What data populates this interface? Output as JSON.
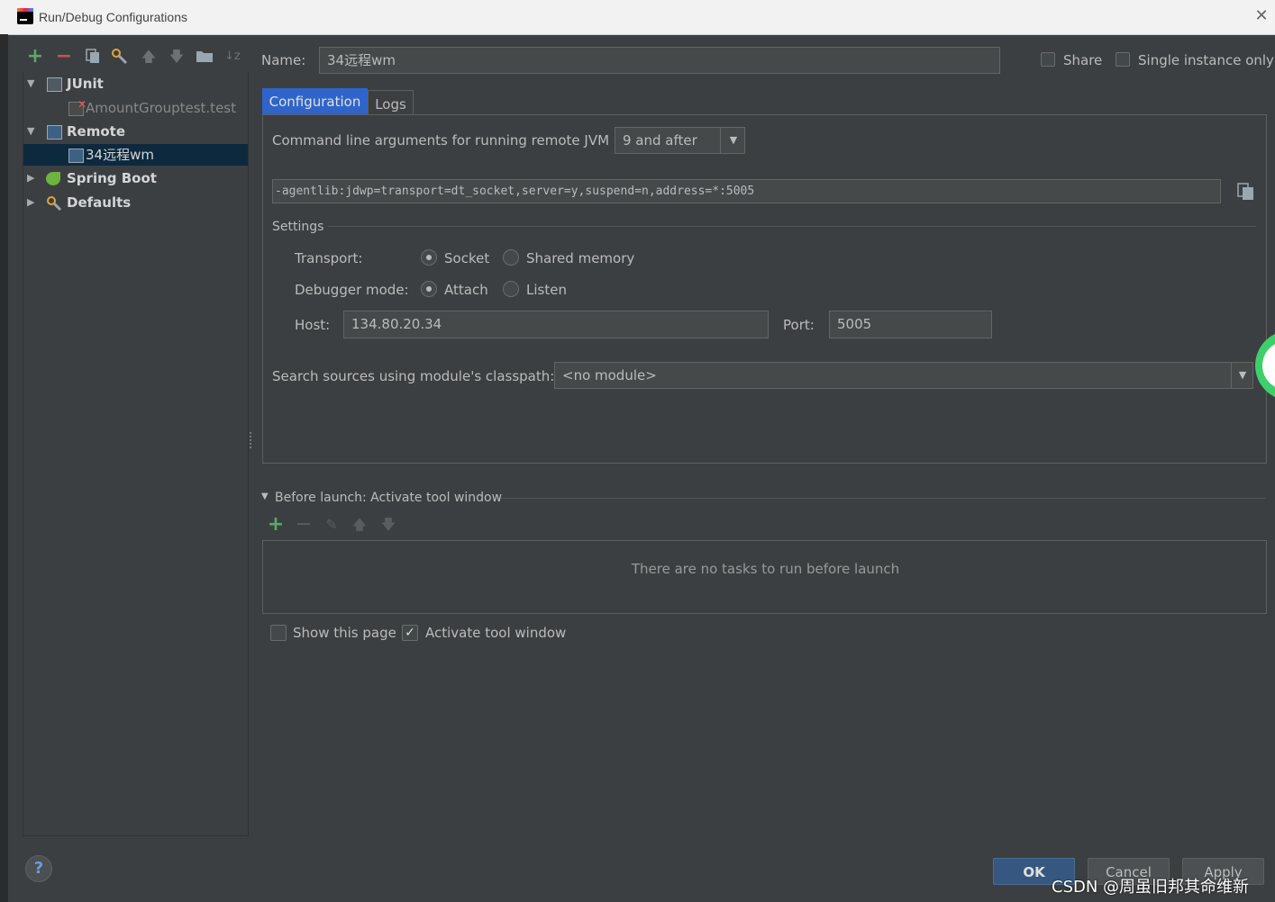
{
  "window": {
    "title": "Run/Debug Configurations"
  },
  "toolbar": {
    "icons": [
      "add-icon",
      "remove-icon",
      "copy-icon",
      "wrench-icon",
      "arrow-up-icon",
      "arrow-down-icon",
      "folder-icon",
      "sort-icon"
    ]
  },
  "tree": {
    "items": [
      {
        "label": "JUnit",
        "level": 0,
        "expanded": true,
        "bold": true
      },
      {
        "label": "AmountGrouptest.test",
        "level": 1,
        "dimmed": true
      },
      {
        "label": "Remote",
        "level": 0,
        "expanded": true,
        "bold": true
      },
      {
        "label": "34远程wm",
        "level": 1,
        "selected": true
      },
      {
        "label": "Spring Boot",
        "level": 0,
        "expanded": false,
        "bold": true
      },
      {
        "label": "Defaults",
        "level": 0,
        "expanded": false,
        "bold": true
      }
    ]
  },
  "name_field": {
    "label": "Name:",
    "value": "34远程wm"
  },
  "share": {
    "label": "Share",
    "checked": false
  },
  "single_instance": {
    "label": "Single instance only",
    "checked": false
  },
  "tabs": [
    {
      "label": "Configuration",
      "active": true
    },
    {
      "label": "Logs",
      "active": false
    }
  ],
  "config": {
    "jvm_label": "Command line arguments for running remote JVM",
    "jvm_select": "9 and after",
    "args_value": "-agentlib:jdwp=transport=dt_socket,server=y,suspend=n,address=*:5005",
    "settings_title": "Settings",
    "transport_label": "Transport:",
    "transport_options": [
      "Socket",
      "Shared memory"
    ],
    "transport_selected": "Socket",
    "debugger_label": "Debugger mode:",
    "debugger_options": [
      "Attach",
      "Listen"
    ],
    "debugger_selected": "Attach",
    "host_label": "Host:",
    "host_value": "134.80.20.34",
    "port_label": "Port:",
    "port_value": "5005",
    "module_label": "Search sources using module's classpath:",
    "module_value": "<no module>"
  },
  "before_launch": {
    "title": "Before launch: Activate tool window",
    "empty_text": "There are no tasks to run before launch",
    "show_page_label": "Show this page",
    "show_page_checked": false,
    "activate_label": "Activate tool window",
    "activate_checked": true
  },
  "buttons": {
    "ok": "OK",
    "cancel": "Cancel",
    "apply": "Apply",
    "help": "?"
  },
  "watermark": "CSDN @周虽旧邦其命维新",
  "colors": {
    "accent_green": "#59a869",
    "accent_red": "#c75450",
    "selection": "#0d293e",
    "primary_button": "#365880"
  }
}
